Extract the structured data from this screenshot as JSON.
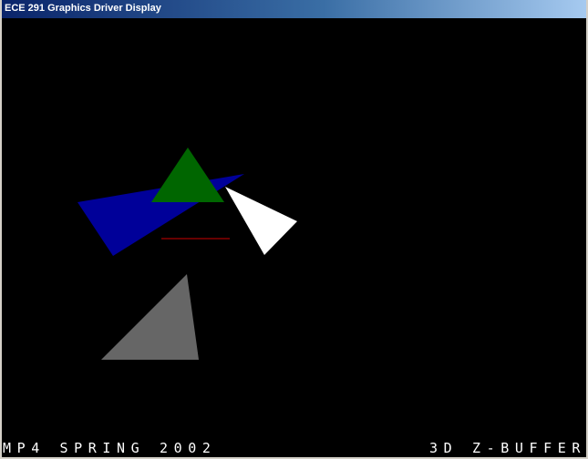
{
  "window": {
    "title": "ECE 291 Graphics Driver Display"
  },
  "display": {
    "background": "#000000",
    "status_left": "MP4 SPRING 2002",
    "status_right": "3D Z-BUFFER"
  },
  "shapes": {
    "blue": "#000099",
    "green": "#006600",
    "white": "#ffffff",
    "gray": "#666666",
    "red": "#cc0000"
  }
}
